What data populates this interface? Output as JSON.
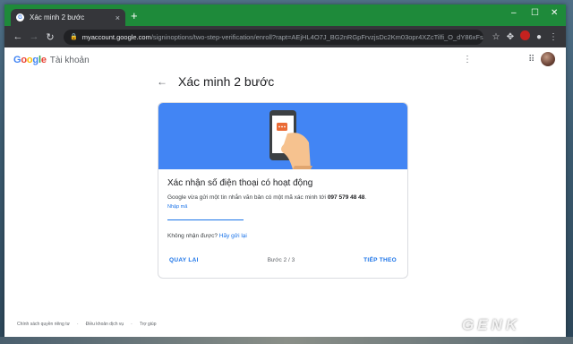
{
  "browser": {
    "tab_title": "Xác minh 2 bước",
    "tab_close": "×",
    "new_tab": "+",
    "win_minimize": "–",
    "win_maximize": "☐",
    "win_close": "✕",
    "url_domain": "myaccount.google.com",
    "url_path": "/signinoptions/two-step-verification/enroll?rapt=AEjHL4O7J_BG2nRGpFrvzjsDc2Km03opr4XZcTilfi_O_dY86xFs..."
  },
  "header": {
    "logo": "Google",
    "title": "Tài khoản"
  },
  "page": {
    "heading": "Xác minh 2 bước"
  },
  "card": {
    "title": "Xác nhận số điện thoại có hoạt động",
    "desc_prefix": "Google vừa gửi một tin nhắn văn bản có một mã xác minh tới ",
    "phone": "097 579 48 48",
    "desc_suffix": ".",
    "input_label": "Nhập mã",
    "resend_prefix": "Không nhận được? ",
    "resend_link": "Hãy gửi lại",
    "back_button": "QUAY LẠI",
    "step": "Bước 2 / 3",
    "next_button": "TIẾP THEO"
  },
  "footer": {
    "links": [
      "Chính sách quyền riêng tư",
      "·",
      "Điều khoản dịch vụ",
      "·",
      "Trợ giúp"
    ]
  },
  "watermark": "GENK",
  "colors": {
    "title_bar": "#1e8a3a",
    "banner": "#4285f4",
    "link": "#1a73e8"
  }
}
